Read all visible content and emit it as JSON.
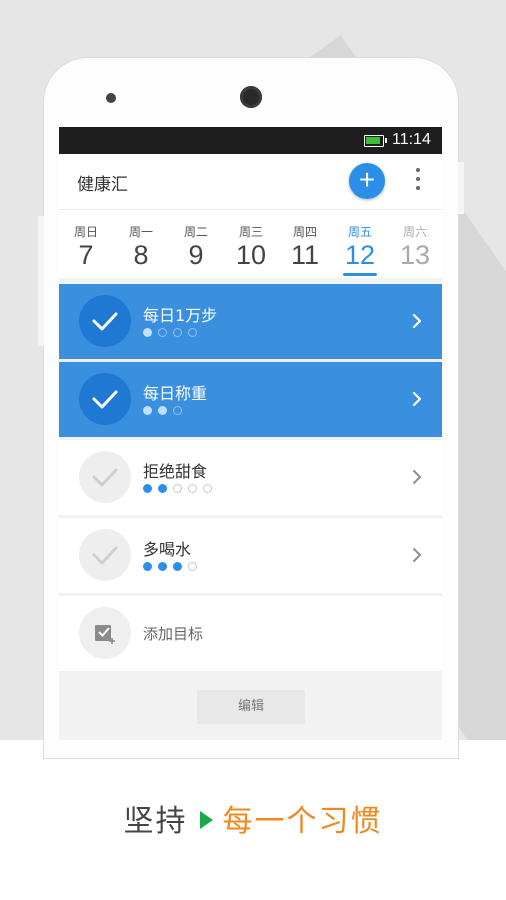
{
  "statusbar": {
    "time": "11:14",
    "battery_icon": "battery-icon"
  },
  "appbar": {
    "title": "健康汇",
    "add_icon": "+",
    "more_icon": "more-vert-icon"
  },
  "week": [
    {
      "name": "周日",
      "date": "7",
      "state": "normal"
    },
    {
      "name": "周一",
      "date": "8",
      "state": "normal"
    },
    {
      "name": "周二",
      "date": "9",
      "state": "normal"
    },
    {
      "name": "周三",
      "date": "10",
      "state": "normal"
    },
    {
      "name": "周四",
      "date": "11",
      "state": "normal"
    },
    {
      "name": "周五",
      "date": "12",
      "state": "active"
    },
    {
      "name": "周六",
      "date": "13",
      "state": "dim"
    }
  ],
  "habits": [
    {
      "title": "每日1万步",
      "done": true,
      "progress_filled": 1,
      "progress_total": 4
    },
    {
      "title": "每日称重",
      "done": true,
      "progress_filled": 2,
      "progress_total": 3
    },
    {
      "title": "拒绝甜食",
      "done": false,
      "progress_filled": 2,
      "progress_total": 5
    },
    {
      "title": "多喝水",
      "done": false,
      "progress_filled": 3,
      "progress_total": 4
    }
  ],
  "add_goal": {
    "label": "添加目标"
  },
  "edit_button": {
    "label": "编辑"
  },
  "tagline": {
    "part1": "坚持",
    "part2": "每一个习惯"
  },
  "colors": {
    "accent": "#2b8ee8",
    "done_row": "#3b8fdf",
    "tagline_orange": "#f2871e",
    "play_green": "#1aa84d"
  }
}
